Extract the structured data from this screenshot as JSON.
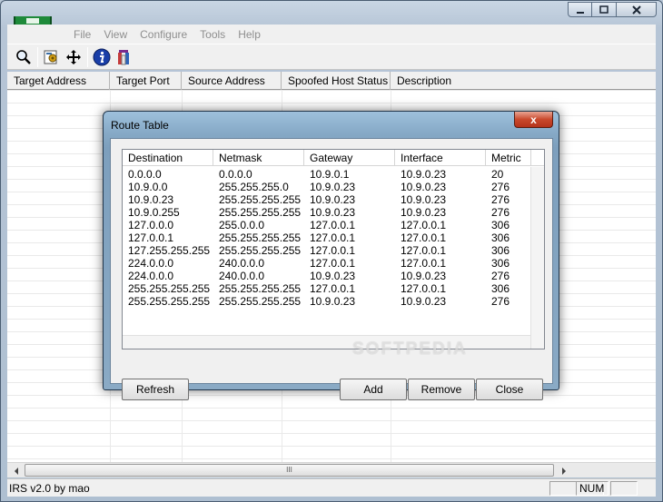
{
  "menu": [
    "File",
    "View",
    "Configure",
    "Tools",
    "Help"
  ],
  "toolbar": {
    "icons": [
      "search-icon",
      "settings-icon",
      "move-icon",
      "info-icon",
      "remove-icon"
    ]
  },
  "list": {
    "columns": [
      "Target Address",
      "Target Port",
      "Source Address",
      "Spoofed Host Status",
      "Description"
    ]
  },
  "status": {
    "text": "IRS v2.0 by mao",
    "num": "NUM"
  },
  "scroll": {
    "thumb_grip": "III"
  },
  "dialog": {
    "title": "Route Table",
    "close_label": "x",
    "columns": [
      "Destination",
      "Netmask",
      "Gateway",
      "Interface",
      "Metric"
    ],
    "rows": [
      [
        "0.0.0.0",
        "0.0.0.0",
        "10.9.0.1",
        "10.9.0.23",
        "20"
      ],
      [
        "10.9.0.0",
        "255.255.255.0",
        "10.9.0.23",
        "10.9.0.23",
        "276"
      ],
      [
        "10.9.0.23",
        "255.255.255.255",
        "10.9.0.23",
        "10.9.0.23",
        "276"
      ],
      [
        "10.9.0.255",
        "255.255.255.255",
        "10.9.0.23",
        "10.9.0.23",
        "276"
      ],
      [
        "127.0.0.0",
        "255.0.0.0",
        "127.0.0.1",
        "127.0.0.1",
        "306"
      ],
      [
        "127.0.0.1",
        "255.255.255.255",
        "127.0.0.1",
        "127.0.0.1",
        "306"
      ],
      [
        "127.255.255.255",
        "255.255.255.255",
        "127.0.0.1",
        "127.0.0.1",
        "306"
      ],
      [
        "224.0.0.0",
        "240.0.0.0",
        "127.0.0.1",
        "127.0.0.1",
        "306"
      ],
      [
        "224.0.0.0",
        "240.0.0.0",
        "10.9.0.23",
        "10.9.0.23",
        "276"
      ],
      [
        "255.255.255.255",
        "255.255.255.255",
        "127.0.0.1",
        "127.0.0.1",
        "306"
      ],
      [
        "255.255.255.255",
        "255.255.255.255",
        "10.9.0.23",
        "10.9.0.23",
        "276"
      ]
    ],
    "buttons": {
      "refresh": "Refresh",
      "add": "Add",
      "remove": "Remove",
      "close": "Close"
    }
  },
  "watermark": "SOFTPEDIA"
}
